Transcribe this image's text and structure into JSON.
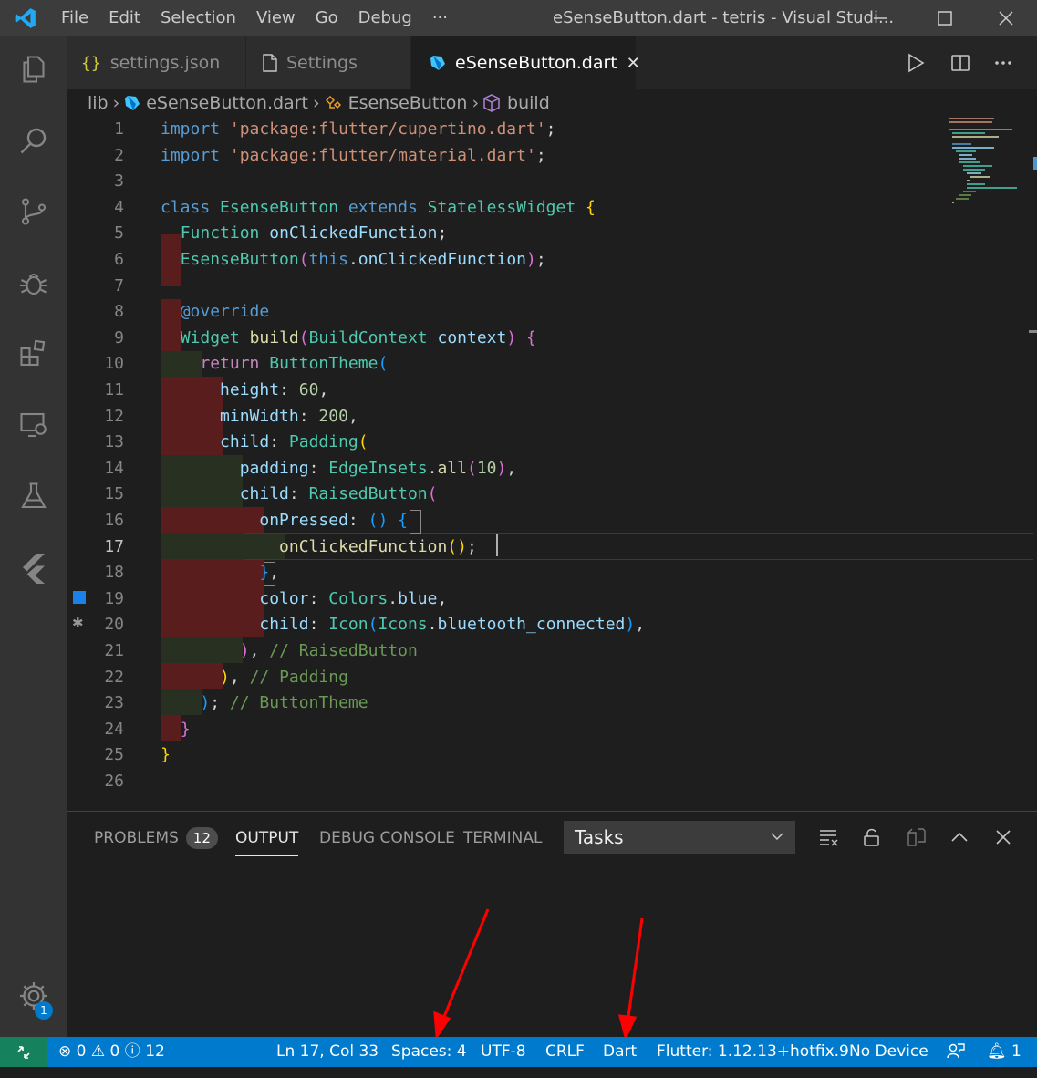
{
  "menu": [
    "File",
    "Edit",
    "Selection",
    "View",
    "Go",
    "Debug",
    "···"
  ],
  "window_title": "eSenseButton.dart - tetris - Visual Studi...",
  "tabs": [
    {
      "label": "settings.json",
      "icon": "json-braces-icon"
    },
    {
      "label": "Settings",
      "icon": "file-icon"
    },
    {
      "label": "eSenseButton.dart",
      "icon": "dart-icon",
      "close": "✕"
    }
  ],
  "breadcrumb": {
    "folder": "lib",
    "file": "eSenseButton.dart",
    "class": "EsenseButton",
    "method": "build"
  },
  "line_numbers": [
    "1",
    "2",
    "3",
    "4",
    "5",
    "6",
    "7",
    "8",
    "9",
    "10",
    "11",
    "12",
    "13",
    "14",
    "15",
    "16",
    "17",
    "18",
    "19",
    "20",
    "21",
    "22",
    "23",
    "24",
    "25",
    "26"
  ],
  "code_lines": [
    "import 'package:flutter/cupertino.dart';",
    "import 'package:flutter/material.dart';",
    "",
    "class EsenseButton extends StatelessWidget {",
    "  Function onClickedFunction;",
    "  EsenseButton(this.onClickedFunction);",
    "",
    "  @override",
    "  Widget build(BuildContext context) {",
    "    return ButtonTheme(",
    "      height: 60,",
    "      minWidth: 200,",
    "      child: Padding(",
    "        padding: EdgeInsets.all(10),",
    "        child: RaisedButton(",
    "          onPressed: () {",
    "            onClickedFunction();",
    "          },",
    "          color: Colors.blue,",
    "          child: Icon(Icons.bluetooth_connected),",
    "        ), // RaisedButton",
    "      ), // Padding",
    "    ); // ButtonTheme",
    "  }",
    "}",
    ""
  ],
  "panel": {
    "tabs": [
      {
        "label": "PROBLEMS",
        "badge": "12"
      },
      {
        "label": "OUTPUT"
      },
      {
        "label": "DEBUG CONSOLE"
      },
      {
        "label": "TERMINAL"
      }
    ],
    "active_tab": "OUTPUT",
    "dropdown_value": "Tasks"
  },
  "status": {
    "errors": "0",
    "warnings": "0",
    "infos": "12",
    "position": "Ln 17, Col 33",
    "spaces": "Spaces: 4",
    "encoding": "UTF-8",
    "eol": "CRLF",
    "language": "Dart",
    "flutter": "Flutter: 1.12.13+hotfix.9",
    "device": "No Device",
    "notifications": "1"
  },
  "settings_badge": "1",
  "colors": {
    "accent": "#007acc",
    "remote": "#16825d",
    "annotation_arrow": "#ff0000"
  }
}
